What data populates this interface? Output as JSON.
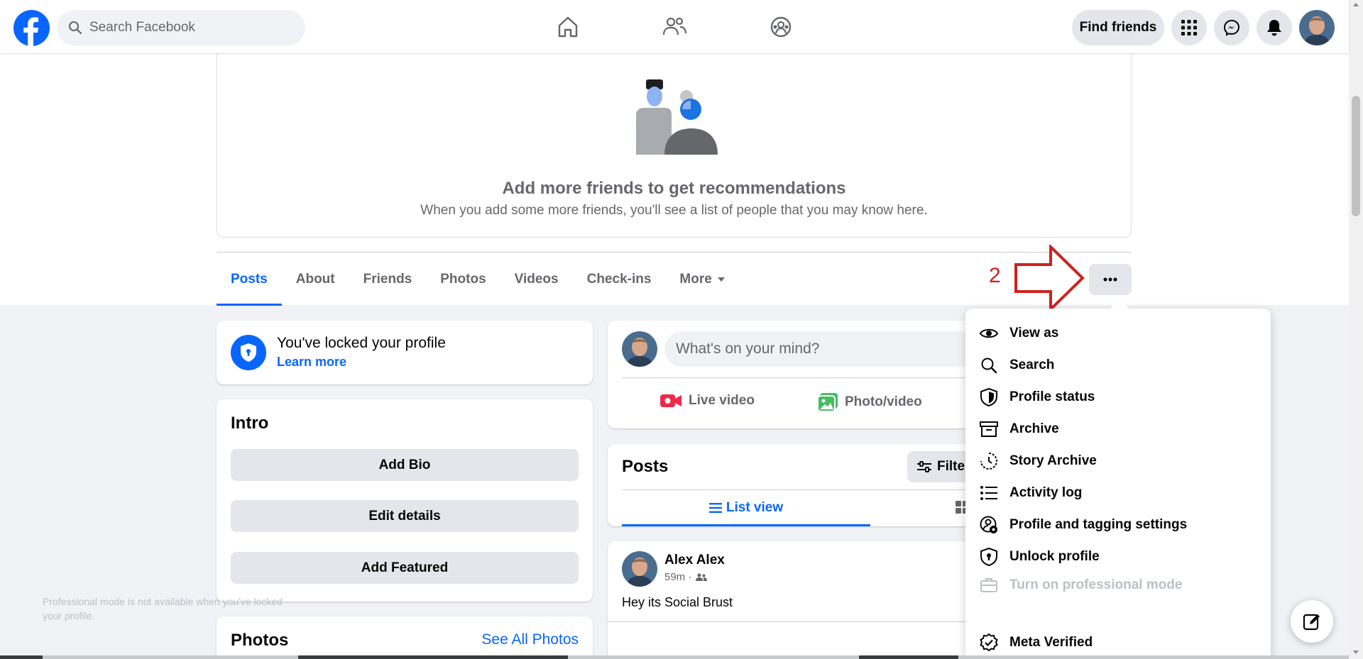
{
  "topbar": {
    "search_placeholder": "Search Facebook",
    "find_friends_label": "Find friends",
    "nav_icons": [
      "home-icon",
      "friends-icon",
      "groups-icon"
    ],
    "right_icons": [
      "menu-grid-icon",
      "messenger-icon",
      "notifications-icon"
    ],
    "brand_color": "#0866ff"
  },
  "recommendations": {
    "title": "Add more friends to get recommendations",
    "subtitle": "When you add some more friends, you'll see a list of people that you may know here."
  },
  "profile_tabs": [
    {
      "label": "Posts",
      "active": true
    },
    {
      "label": "About"
    },
    {
      "label": "Friends"
    },
    {
      "label": "Photos"
    },
    {
      "label": "Videos"
    },
    {
      "label": "Check-ins"
    },
    {
      "label": "More"
    }
  ],
  "annotation": {
    "step_number": "2",
    "color": "#d02020"
  },
  "locked_profile": {
    "title": "You've locked your profile",
    "link": "Learn more"
  },
  "intro": {
    "title": "Intro",
    "buttons": [
      "Add Bio",
      "Edit details",
      "Add Featured"
    ]
  },
  "photos": {
    "title": "Photos",
    "see_all": "See All Photos"
  },
  "composer": {
    "placeholder": "What's on your mind?",
    "actions": [
      "Live video",
      "Photo/video"
    ]
  },
  "posts_section": {
    "title": "Posts",
    "filter_label": "Filter",
    "list_view_label": "List view"
  },
  "post": {
    "author": "Alex Alex",
    "time": "59m ·",
    "text": "Hey its Social Brust"
  },
  "dropdown_menu": {
    "items": [
      {
        "label": "View as",
        "icon": "eye-icon"
      },
      {
        "label": "Search",
        "icon": "search-icon"
      },
      {
        "label": "Profile status",
        "icon": "shield-icon"
      },
      {
        "label": "Archive",
        "icon": "archive-icon"
      },
      {
        "label": "Story Archive",
        "icon": "story-archive-icon"
      },
      {
        "label": "Activity log",
        "icon": "list-icon"
      },
      {
        "label": "Profile and tagging settings",
        "icon": "profile-settings-icon"
      },
      {
        "label": "Unlock profile",
        "icon": "unlock-shield-icon"
      },
      {
        "label": "Turn on professional mode",
        "icon": "briefcase-icon",
        "disabled": true
      },
      {
        "label": "Meta Verified",
        "icon": "verified-badge-icon"
      }
    ],
    "professional_mode_note": "Professional mode is not available when you've locked your profile."
  }
}
